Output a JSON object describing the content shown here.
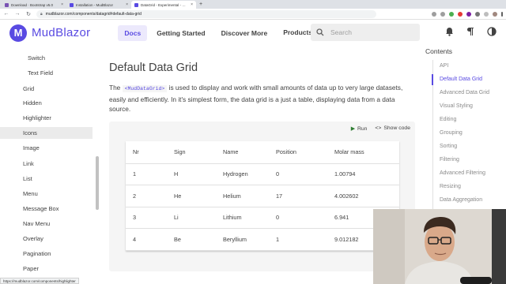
{
  "browser": {
    "tabs": [
      {
        "title": "Download · Bootstrap v5.0",
        "color": "#7952b3",
        "active": false
      },
      {
        "title": "Installation - MudBlazor",
        "color": "#594ae2",
        "active": false
      },
      {
        "title": "DataGrid - Experimental - MudBl",
        "color": "#594ae2",
        "active": true
      }
    ],
    "new_tab": "+",
    "url": "mudblazor.com/components/datagrid#default-data-grid",
    "status_url": "https://mudblazor.com/components/highlighter"
  },
  "appbar": {
    "logo_letter": "M",
    "brand": "MudBlazor",
    "nav": [
      "Docs",
      "Getting Started",
      "Discover More",
      "Products"
    ],
    "products_caret": "⌄",
    "search_placeholder": "Search",
    "icons": [
      "bell-icon",
      "paragraph-icon",
      "dark-mode-icon"
    ]
  },
  "sidebar": {
    "items": [
      "Switch",
      "Text Field",
      "Grid",
      "Hidden",
      "Highlighter",
      "Icons",
      "Image",
      "Link",
      "List",
      "Menu",
      "Message Box",
      "Nav Menu",
      "Overlay",
      "Pagination",
      "Paper"
    ]
  },
  "main": {
    "title": "Default Data Grid",
    "para_prefix": "The ",
    "para_code": "<MudDataGrid>",
    "para_suffix": " is used to display and work with small amounts of data up to very large datasets, easily and efficiently. In it's simplest form, the data grid is a just a table, displaying data from a data source.",
    "run_label": "Run",
    "show_code_label": "Show code",
    "table": {
      "headers": [
        "Nr",
        "Sign",
        "Name",
        "Position",
        "Molar mass"
      ],
      "rows": [
        [
          "1",
          "H",
          "Hydrogen",
          "0",
          "1.00794"
        ],
        [
          "2",
          "He",
          "Helium",
          "17",
          "4.002602"
        ],
        [
          "3",
          "Li",
          "Lithium",
          "0",
          "6.941"
        ],
        [
          "4",
          "Be",
          "Beryllium",
          "1",
          "9.012182"
        ]
      ]
    }
  },
  "contents": {
    "title": "Contents",
    "items": [
      "API",
      "Default Data Grid",
      "Advanced Data Grid",
      "Visual Styling",
      "Editing",
      "Grouping",
      "Sorting",
      "Filtering",
      "Advanced Filtering",
      "Resizing",
      "Data Aggregation"
    ],
    "active_index": 1
  },
  "colors": {
    "accent": "#594ae2"
  }
}
